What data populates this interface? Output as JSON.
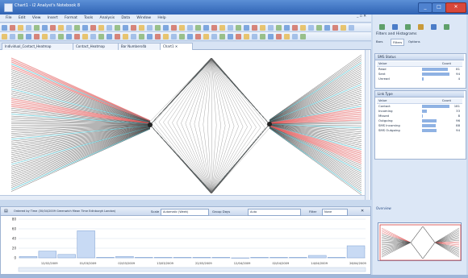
{
  "window": {
    "title": "Chart1 - i2 Analyst's Notebook 8",
    "min": "_",
    "max": "□",
    "close": "✕"
  },
  "menu": [
    "File",
    "Edit",
    "View",
    "Insert",
    "Format",
    "Tools",
    "Analysis",
    "Data",
    "Window",
    "Help"
  ],
  "tabs": [
    {
      "label": "Individual_Contact_Heatmap",
      "active": false
    },
    {
      "label": "Contact_Heatmap",
      "active": false
    },
    {
      "label": "Bar Numbers4b",
      "active": false
    },
    {
      "label": "Chart1",
      "active": true
    }
  ],
  "histogram_panel": {
    "header": "Ordered by Time (30/04/2009 Greenwich Mean Time Edinburgh London)",
    "scale_label": "Scale",
    "scale_value": "Automatic (Week)",
    "group_label": "Group Days",
    "group_value": "Auto",
    "filter_label": "Filter",
    "filter_value": "None"
  },
  "chart_data": {
    "type": "bar",
    "categories": [
      "",
      "",
      "",
      "",
      "",
      "",
      "",
      "",
      "",
      "",
      "",
      "",
      "",
      "",
      "",
      "",
      "",
      ""
    ],
    "values": [
      3,
      14,
      7,
      56,
      1,
      3,
      1,
      1,
      1,
      1,
      1,
      0,
      1,
      1,
      1,
      5,
      1,
      25
    ],
    "yticks": [
      "80",
      "60",
      "40",
      "20",
      "0"
    ],
    "ylim": [
      0,
      80
    ],
    "xtick_labels": [
      "12/02/2009",
      "01/03/2009",
      "02/03/2009",
      "13/03/2009",
      "22/03/2009",
      "12/04/2009",
      "02/04/2009",
      "14/04/2009",
      "26/04/2009"
    ]
  },
  "right_panel": {
    "title": "Filters and Histograms",
    "subtabs": [
      "Bars",
      "Filters",
      "Options"
    ],
    "active_subtab": "Filters",
    "status_section": {
      "title": "SMS Status",
      "col_value": "Value",
      "col_count": "Count",
      "rows": [
        {
          "label": "Read",
          "count": 81,
          "frac": 0.95
        },
        {
          "label": "Sent",
          "count": 94,
          "frac": 1.0
        },
        {
          "label": "Unread",
          "count": 4,
          "frac": 0.05
        }
      ]
    },
    "type_section": {
      "title": "Link Type",
      "col_value": "Value",
      "col_count": "Count",
      "rows": [
        {
          "label": "Contact",
          "count": 181,
          "frac": 1.0
        },
        {
          "label": "Incoming",
          "count": 33,
          "frac": 0.18
        },
        {
          "label": "Missed",
          "count": 8,
          "frac": 0.04
        },
        {
          "label": "Outgoing",
          "count": 96,
          "frac": 0.53
        },
        {
          "label": "SMS Incoming",
          "count": 88,
          "frac": 0.49
        },
        {
          "label": "SMS Outgoing",
          "count": 94,
          "frac": 0.52
        }
      ]
    },
    "overview_label": "Overview"
  },
  "colors": {
    "titlebar": "#2f63b4",
    "accent": "#8fb2e3",
    "line_red": "#e05050",
    "line_cyan": "#3fb8c8",
    "bar_fill": "#c8daf4"
  }
}
